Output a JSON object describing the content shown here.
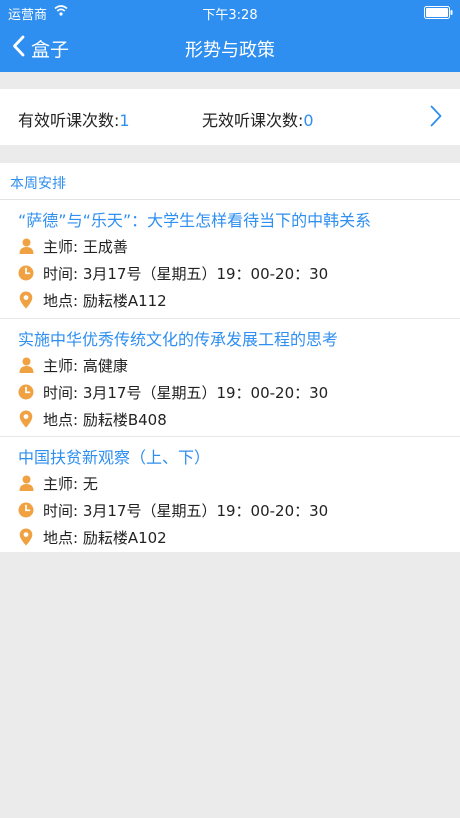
{
  "status_bar": {
    "carrier": "运营商",
    "time": "下午3:28"
  },
  "nav": {
    "back_label": "盒子",
    "title": "形势与政策"
  },
  "counts": {
    "valid_label": "有效听课次数:",
    "valid_value": "1",
    "invalid_label": "无效听课次数:",
    "invalid_value": "0"
  },
  "schedule": {
    "section_title": "本周安排",
    "items": [
      {
        "title": "“萨德”与“乐天”：大学生怎样看待当下的中韩关系",
        "lecturer": "主师: 王成善",
        "time": "时间: 3月17号（星期五）19：00-20：30",
        "location": "地点: 励耘楼A112"
      },
      {
        "title": "实施中华优秀传统文化的传承发展工程的思考",
        "lecturer": "主师: 高健康",
        "time": "时间: 3月17号（星期五）19：00-20：30",
        "location": "地点: 励耘楼B408"
      },
      {
        "title": "中国扶贫新观察（上、下）",
        "lecturer": "主师: 无",
        "time": "时间: 3月17号（星期五）19：00-20：30",
        "location": "地点: 励耘楼A102"
      }
    ]
  },
  "colors": {
    "accent": "#2f8ff0",
    "icon": "#f0a243",
    "background": "#ebebeb"
  },
  "icons": {
    "lecturer": "person-icon",
    "time": "clock-icon",
    "location": "location-pin-icon"
  }
}
